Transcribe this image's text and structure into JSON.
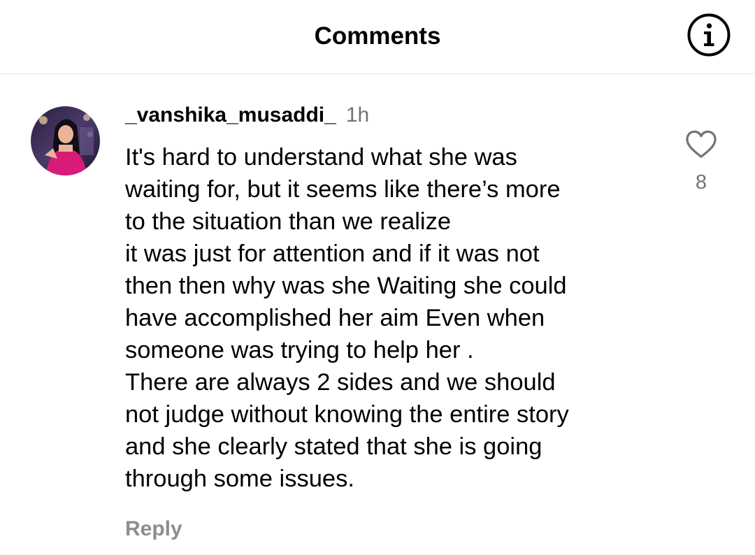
{
  "header": {
    "title": "Comments",
    "info_icon": "info-icon"
  },
  "comment": {
    "username": "_vanshika_musaddi_",
    "time": "1h",
    "text": "It's hard to understand what she was\nwaiting for, but it seems like there’s more\nto the situation than we realize\nit was just for attention and if it was not\nthen then why was she Waiting she could\nhave accomplished her aim Even when\nsomeone was trying to help her .\nThere are always 2 sides and we should\nnot judge without knowing the entire story\nand she clearly stated that she is going\nthrough some issues.",
    "reply_label": "Reply",
    "like_count": "8",
    "like_icon": "heart-outline-icon"
  },
  "colors": {
    "text": "#000000",
    "secondary_text": "#737373",
    "reply_text": "#8e8e8e",
    "divider": "#e6e6e6",
    "avatar_accent": "#d81b78"
  }
}
